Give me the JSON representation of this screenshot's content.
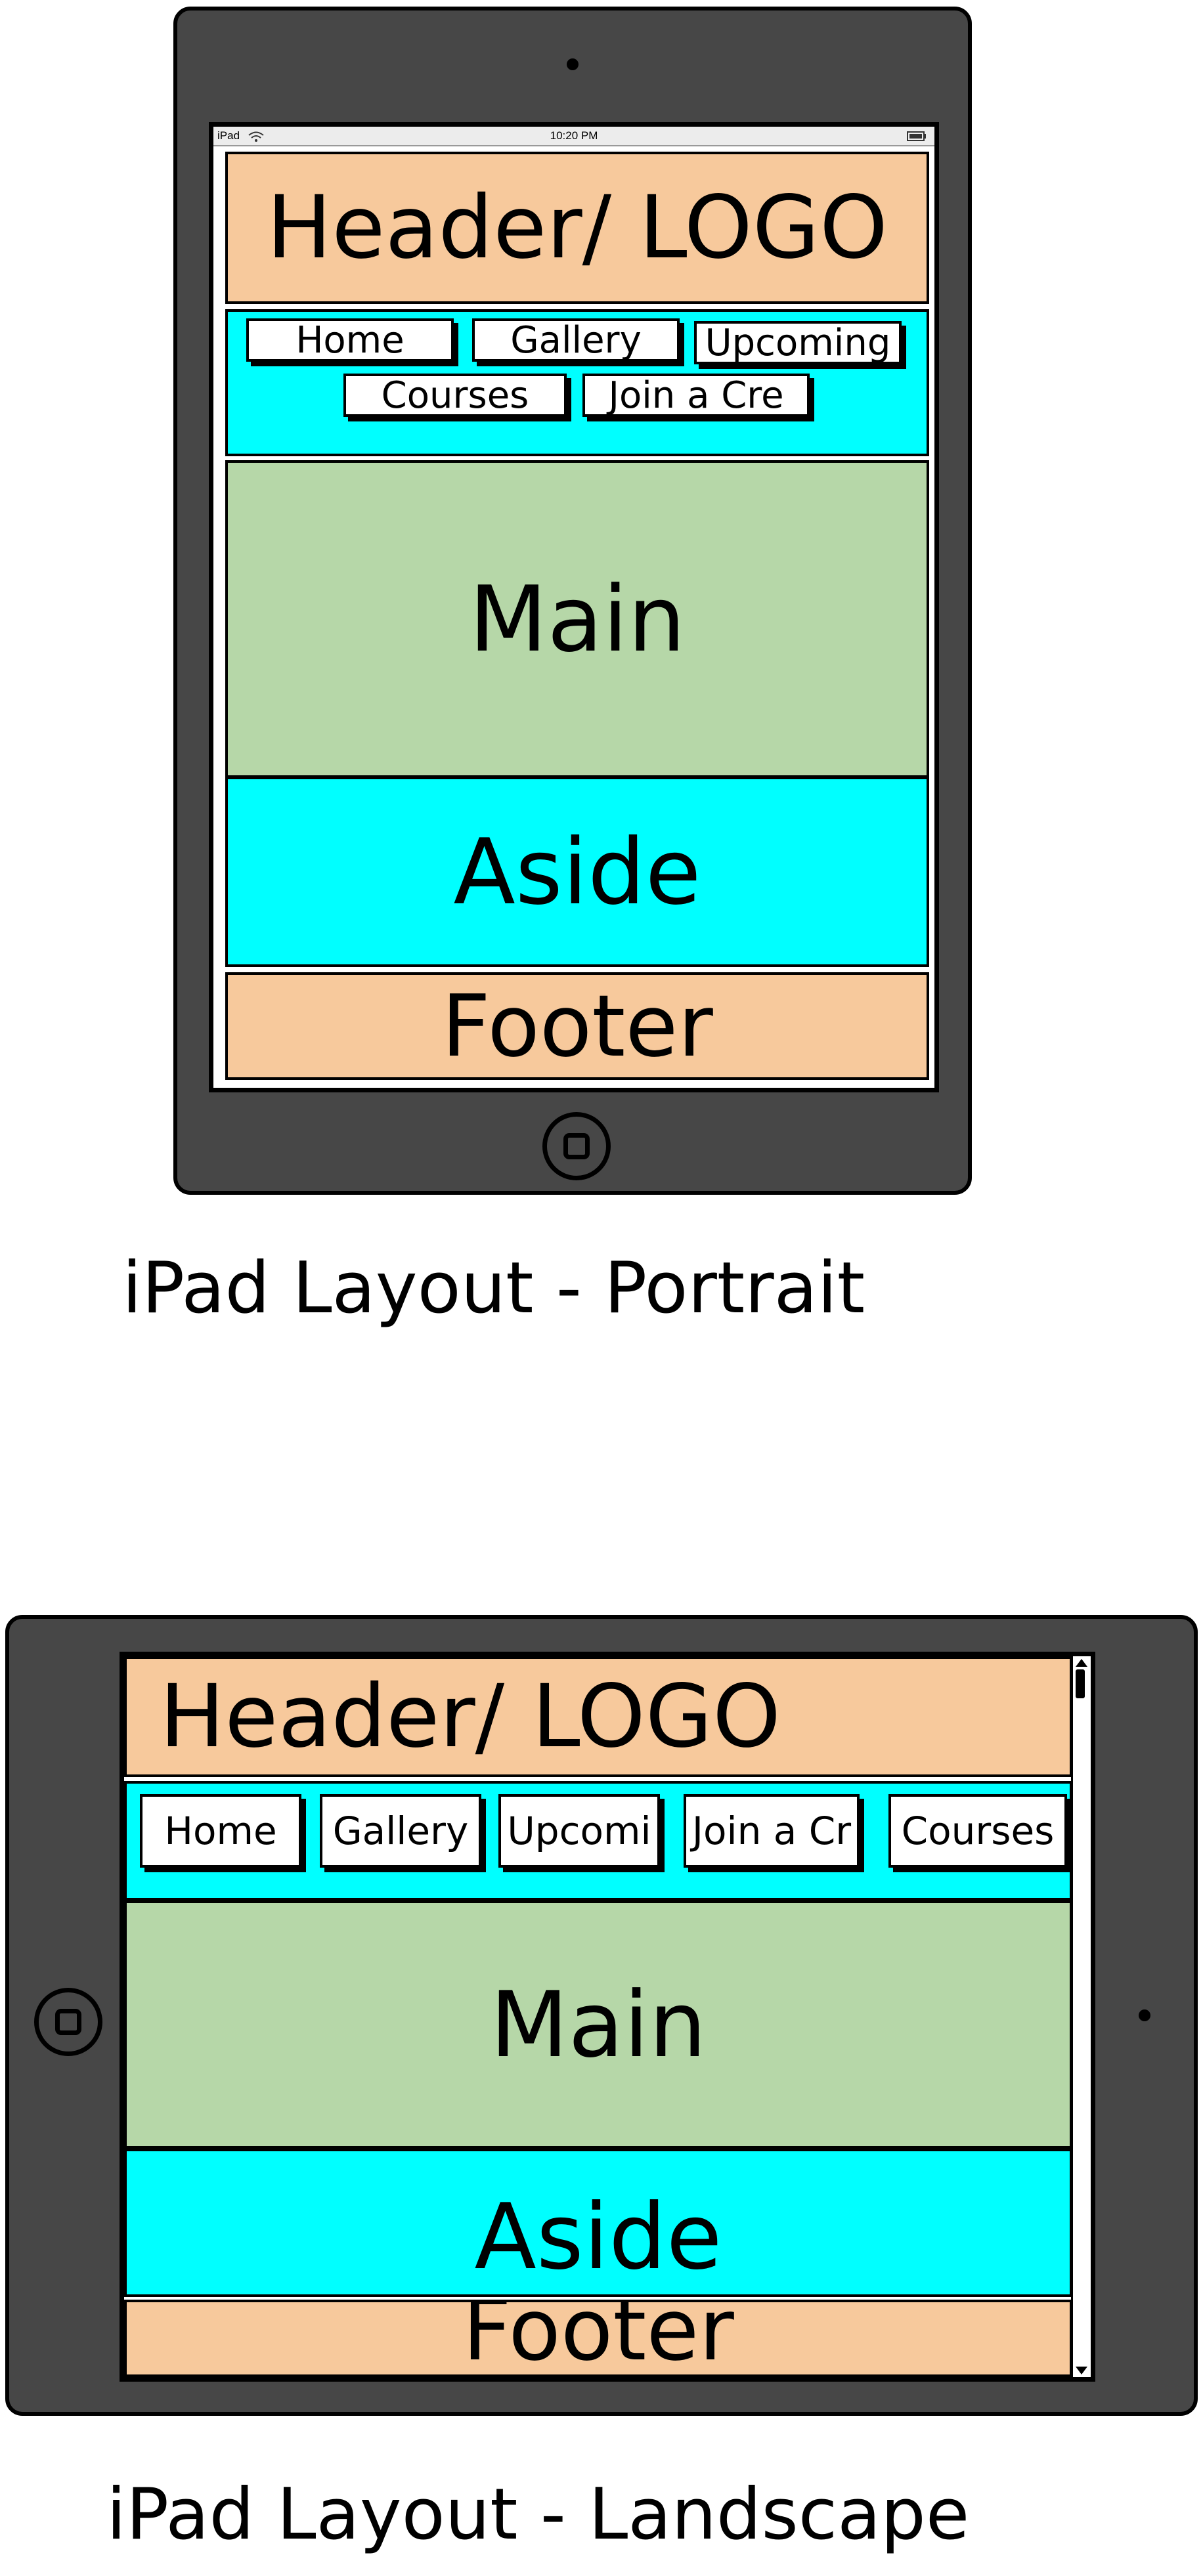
{
  "portrait": {
    "status_bar": {
      "device": "iPad",
      "time": "10:20 PM"
    },
    "header": "Header/ LOGO",
    "nav": [
      "Home",
      "Gallery",
      "Upcoming",
      "Courses",
      "Join a Cre"
    ],
    "main": "Main",
    "aside": "Aside",
    "footer": "Footer",
    "caption": "iPad Layout - Portrait"
  },
  "landscape": {
    "header": "Header/ LOGO",
    "nav": [
      "Home",
      "Gallery",
      "Upcomi",
      "Join a Cr",
      "Courses"
    ],
    "main": "Main",
    "aside": "Aside",
    "footer": "Footer",
    "caption": "iPad Layout - Landscape"
  },
  "colors": {
    "device_body": "#474747",
    "header_footer": "#f7c99c",
    "nav_aside": "#00ffff",
    "main": "#b6d7a8"
  },
  "icons": [
    "camera-icon",
    "home-button-icon",
    "wifi-icon",
    "battery-icon",
    "scroll-arrow-up-icon",
    "scroll-arrow-down-icon"
  ]
}
